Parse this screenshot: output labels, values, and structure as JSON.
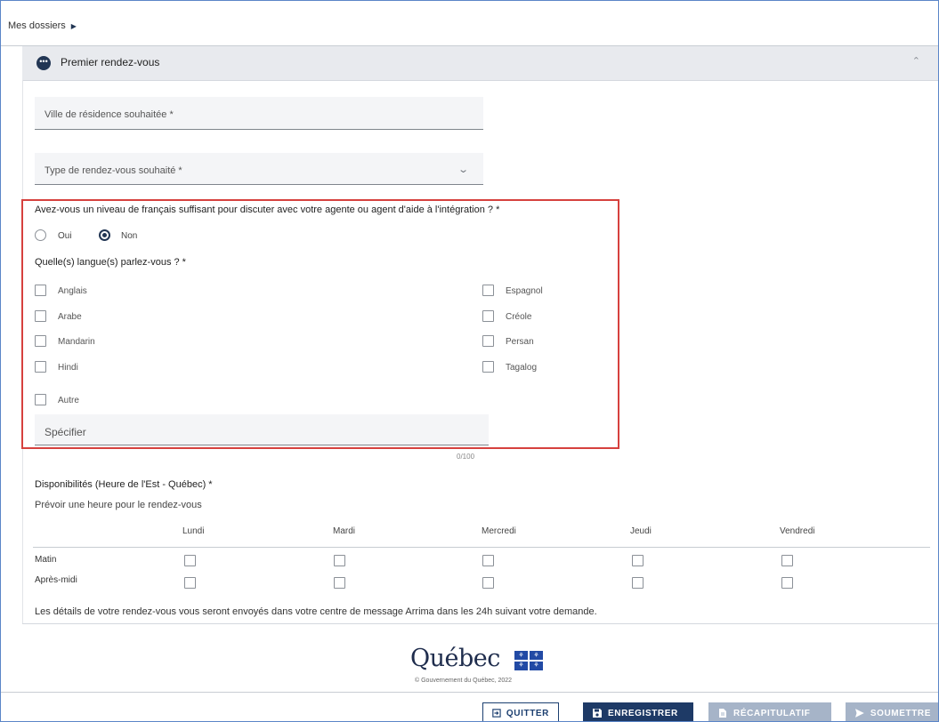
{
  "breadcrumb": {
    "label": "Mes dossiers"
  },
  "panel": {
    "title": "Premier rendez-vous"
  },
  "fields": {
    "ville_placeholder": "Ville de résidence souhaitée *",
    "type_placeholder": "Type de rendez-vous souhaité *"
  },
  "francais": {
    "question": "Avez-vous un niveau de français suffisant pour discuter avec votre agente ou agent d'aide à l'intégration ? *",
    "options": [
      {
        "label": "Oui",
        "selected": false
      },
      {
        "label": "Non",
        "selected": true
      }
    ]
  },
  "langues": {
    "question": "Quelle(s) langue(s) parlez-vous ? *",
    "left": [
      "Anglais",
      "Arabe",
      "Mandarin",
      "Hindi"
    ],
    "right": [
      "Espagnol",
      "Créole",
      "Persan",
      "Tagalog"
    ],
    "other": "Autre",
    "specify_placeholder": "Spécifier",
    "counter": "0/100"
  },
  "disponibilites": {
    "title": "Disponibilités (Heure de l'Est - Québec) *",
    "subtitle": "Prévoir une heure pour le rendez-vous",
    "days": [
      "Lundi",
      "Mardi",
      "Mercredi",
      "Jeudi",
      "Vendredi"
    ],
    "rows": [
      "Matin",
      "Après-midi"
    ]
  },
  "note": "Les détails de votre rendez-vous vous seront envoyés dans votre centre de message Arrima dans les 24h suivant votre demande.",
  "footer": {
    "logo_text": "Québec",
    "copyright": "© Gouvernement du Québec, 2022"
  },
  "buttons": {
    "quitter": "QUITTER",
    "enregistrer": "ENREGISTRER",
    "recapitulatif": "RÉCAPITULATIF",
    "soumettre": "SOUMETTRE"
  },
  "colors": {
    "navy": "#223654",
    "highlight_box": "#d6413e",
    "disabled_button": "#a6b4c8"
  }
}
